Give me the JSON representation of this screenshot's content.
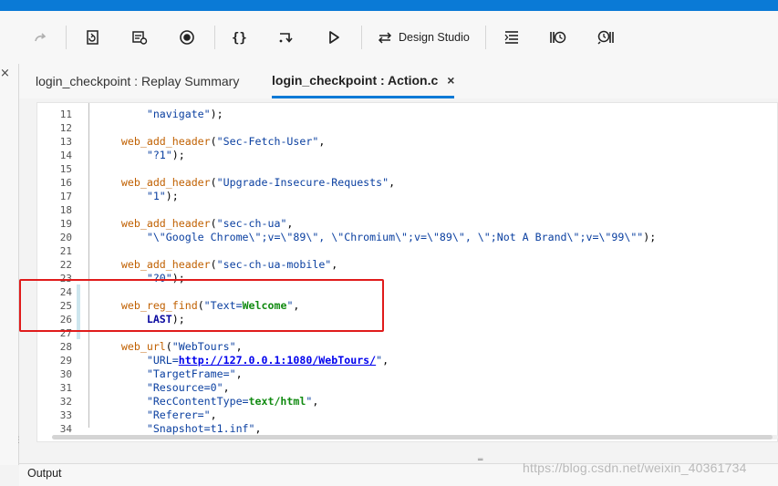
{
  "toolbar": {
    "design_studio_label": "Design Studio"
  },
  "tabs": [
    {
      "label": "login_checkpoint : Replay Summary",
      "active": false
    },
    {
      "label": "login_checkpoint : Action.c",
      "active": true
    }
  ],
  "tab_close_glyph": "×",
  "panel_close_glyph": "×",
  "code": {
    "lines": [
      {
        "n": "11",
        "segs": [
          [
            "t",
            "        "
          ],
          [
            "st",
            "\"navigate\""
          ],
          [
            "t",
            ");"
          ]
        ]
      },
      {
        "n": "12",
        "segs": []
      },
      {
        "n": "13",
        "segs": [
          [
            "t",
            "    "
          ],
          [
            "fn",
            "web_add_header"
          ],
          [
            "t",
            "("
          ],
          [
            "st",
            "\"Sec-Fetch-User\""
          ],
          [
            "t",
            ","
          ]
        ]
      },
      {
        "n": "14",
        "segs": [
          [
            "t",
            "        "
          ],
          [
            "st",
            "\"?1\""
          ],
          [
            "t",
            ");"
          ]
        ]
      },
      {
        "n": "15",
        "segs": []
      },
      {
        "n": "16",
        "segs": [
          [
            "t",
            "    "
          ],
          [
            "fn",
            "web_add_header"
          ],
          [
            "t",
            "("
          ],
          [
            "st",
            "\"Upgrade-Insecure-Requests\""
          ],
          [
            "t",
            ","
          ]
        ]
      },
      {
        "n": "17",
        "segs": [
          [
            "t",
            "        "
          ],
          [
            "st",
            "\"1\""
          ],
          [
            "t",
            ");"
          ]
        ]
      },
      {
        "n": "18",
        "segs": []
      },
      {
        "n": "19",
        "segs": [
          [
            "t",
            "    "
          ],
          [
            "fn",
            "web_add_header"
          ],
          [
            "t",
            "("
          ],
          [
            "st",
            "\"sec-ch-ua\""
          ],
          [
            "t",
            ","
          ]
        ]
      },
      {
        "n": "20",
        "segs": [
          [
            "t",
            "        "
          ],
          [
            "st",
            "\"\\\"Google Chrome\\\";v=\\\"89\\\", \\\"Chromium\\\";v=\\\"89\\\", \\\";Not A Brand\\\";v=\\\"99\\\"\""
          ],
          [
            "t",
            ");"
          ]
        ]
      },
      {
        "n": "21",
        "segs": []
      },
      {
        "n": "22",
        "segs": [
          [
            "t",
            "    "
          ],
          [
            "fn",
            "web_add_header"
          ],
          [
            "t",
            "("
          ],
          [
            "st",
            "\"sec-ch-ua-mobile\""
          ],
          [
            "t",
            ","
          ]
        ]
      },
      {
        "n": "23",
        "segs": [
          [
            "t",
            "        "
          ],
          [
            "st",
            "\"?0\""
          ],
          [
            "t",
            ");"
          ]
        ]
      },
      {
        "n": "24",
        "segs": []
      },
      {
        "n": "25",
        "segs": [
          [
            "t",
            "    "
          ],
          [
            "fn",
            "web_reg_find"
          ],
          [
            "t",
            "("
          ],
          [
            "st",
            "\"Text="
          ],
          [
            "gr",
            "Welcome"
          ],
          [
            "st",
            "\""
          ],
          [
            "t",
            ","
          ]
        ]
      },
      {
        "n": "26",
        "segs": [
          [
            "t",
            "        "
          ],
          [
            "kw",
            "LAST"
          ],
          [
            "t",
            ");"
          ]
        ]
      },
      {
        "n": "27",
        "segs": []
      },
      {
        "n": "28",
        "segs": [
          [
            "t",
            "    "
          ],
          [
            "fn",
            "web_url"
          ],
          [
            "t",
            "("
          ],
          [
            "st",
            "\"WebTours\""
          ],
          [
            "t",
            ","
          ]
        ]
      },
      {
        "n": "29",
        "segs": [
          [
            "t",
            "        "
          ],
          [
            "st",
            "\"URL="
          ],
          [
            "url",
            "http://127.0.0.1:1080/WebTours/"
          ],
          [
            "st",
            "\""
          ],
          [
            "t",
            ","
          ]
        ]
      },
      {
        "n": "30",
        "segs": [
          [
            "t",
            "        "
          ],
          [
            "st",
            "\"TargetFrame=\""
          ],
          [
            "t",
            ","
          ]
        ]
      },
      {
        "n": "31",
        "segs": [
          [
            "t",
            "        "
          ],
          [
            "st",
            "\"Resource=0\""
          ],
          [
            "t",
            ","
          ]
        ]
      },
      {
        "n": "32",
        "segs": [
          [
            "t",
            "        "
          ],
          [
            "st",
            "\"RecContentType="
          ],
          [
            "gr",
            "text/html"
          ],
          [
            "st",
            "\""
          ],
          [
            "t",
            ","
          ]
        ]
      },
      {
        "n": "33",
        "segs": [
          [
            "t",
            "        "
          ],
          [
            "st",
            "\"Referer=\""
          ],
          [
            "t",
            ","
          ]
        ]
      },
      {
        "n": "34",
        "segs": [
          [
            "t",
            "        "
          ],
          [
            "st",
            "\"Snapshot=t1.inf\""
          ],
          [
            "t",
            ","
          ]
        ]
      }
    ]
  },
  "output_label": "Output",
  "watermark": "https://blog.csdn.net/weixin_40361734",
  "colors": {
    "accent": "#0a7ad6",
    "highlight_box": "#e01b1b"
  }
}
